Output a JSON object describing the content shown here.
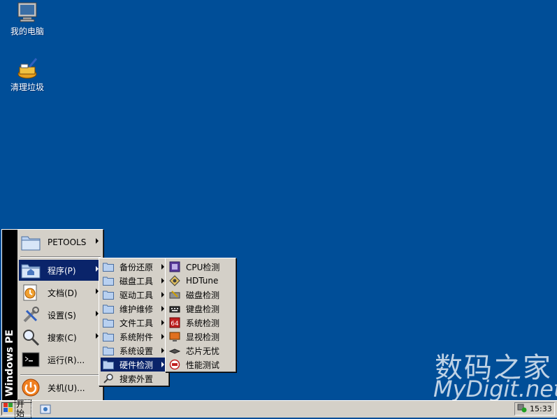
{
  "desktop": {
    "icons": [
      {
        "label": "我的电脑",
        "icon": "computer-icon"
      },
      {
        "label": "清理垃圾",
        "icon": "cleanup-icon"
      }
    ]
  },
  "watermark": {
    "line1": "数码之家",
    "line2": "MyDigit.net"
  },
  "start_menu": {
    "side_label": "Windows PE",
    "items": [
      {
        "label": "PETOOLS",
        "icon": "folder-icon",
        "has_submenu": true
      },
      {
        "label": "程序(P)",
        "icon": "programs-icon",
        "has_submenu": true,
        "selected": true
      },
      {
        "label": "文档(D)",
        "icon": "documents-icon",
        "has_submenu": true
      },
      {
        "label": "设置(S)",
        "icon": "settings-icon",
        "has_submenu": true
      },
      {
        "label": "搜索(C)",
        "icon": "search-icon",
        "has_submenu": true
      },
      {
        "label": "运行(R)...",
        "icon": "run-icon",
        "has_submenu": false
      },
      {
        "label": "关机(U)...",
        "icon": "shutdown-icon",
        "has_submenu": false
      }
    ]
  },
  "programs_menu": {
    "items": [
      {
        "label": "备份还原",
        "has_submenu": true
      },
      {
        "label": "磁盘工具",
        "has_submenu": true
      },
      {
        "label": "驱动工具",
        "has_submenu": true
      },
      {
        "label": "维护维修",
        "has_submenu": true
      },
      {
        "label": "文件工具",
        "has_submenu": true
      },
      {
        "label": "系统附件",
        "has_submenu": true
      },
      {
        "label": "系统设置",
        "has_submenu": true
      },
      {
        "label": "硬件检测",
        "has_submenu": true,
        "selected": true
      },
      {
        "label": "搜索外置",
        "has_submenu": false
      }
    ]
  },
  "hardware_menu": {
    "items": [
      {
        "label": "CPU检测",
        "icon": "cpu-icon"
      },
      {
        "label": "HDTune",
        "icon": "hdtune-icon"
      },
      {
        "label": "磁盘检测",
        "icon": "disk-check-icon"
      },
      {
        "label": "键盘检测",
        "icon": "keyboard-icon"
      },
      {
        "label": "系统检测",
        "icon": "system-check-icon"
      },
      {
        "label": "显视检测",
        "icon": "monitor-icon"
      },
      {
        "label": "芯片无忧",
        "icon": "chip-icon"
      },
      {
        "label": "性能测试",
        "icon": "performance-icon"
      }
    ]
  },
  "taskbar": {
    "start_label": "开始",
    "clock": "15:33"
  },
  "colors": {
    "desktop": "#004e98",
    "menu_bg": "#d4d0c8",
    "selection": "#0a246a"
  }
}
